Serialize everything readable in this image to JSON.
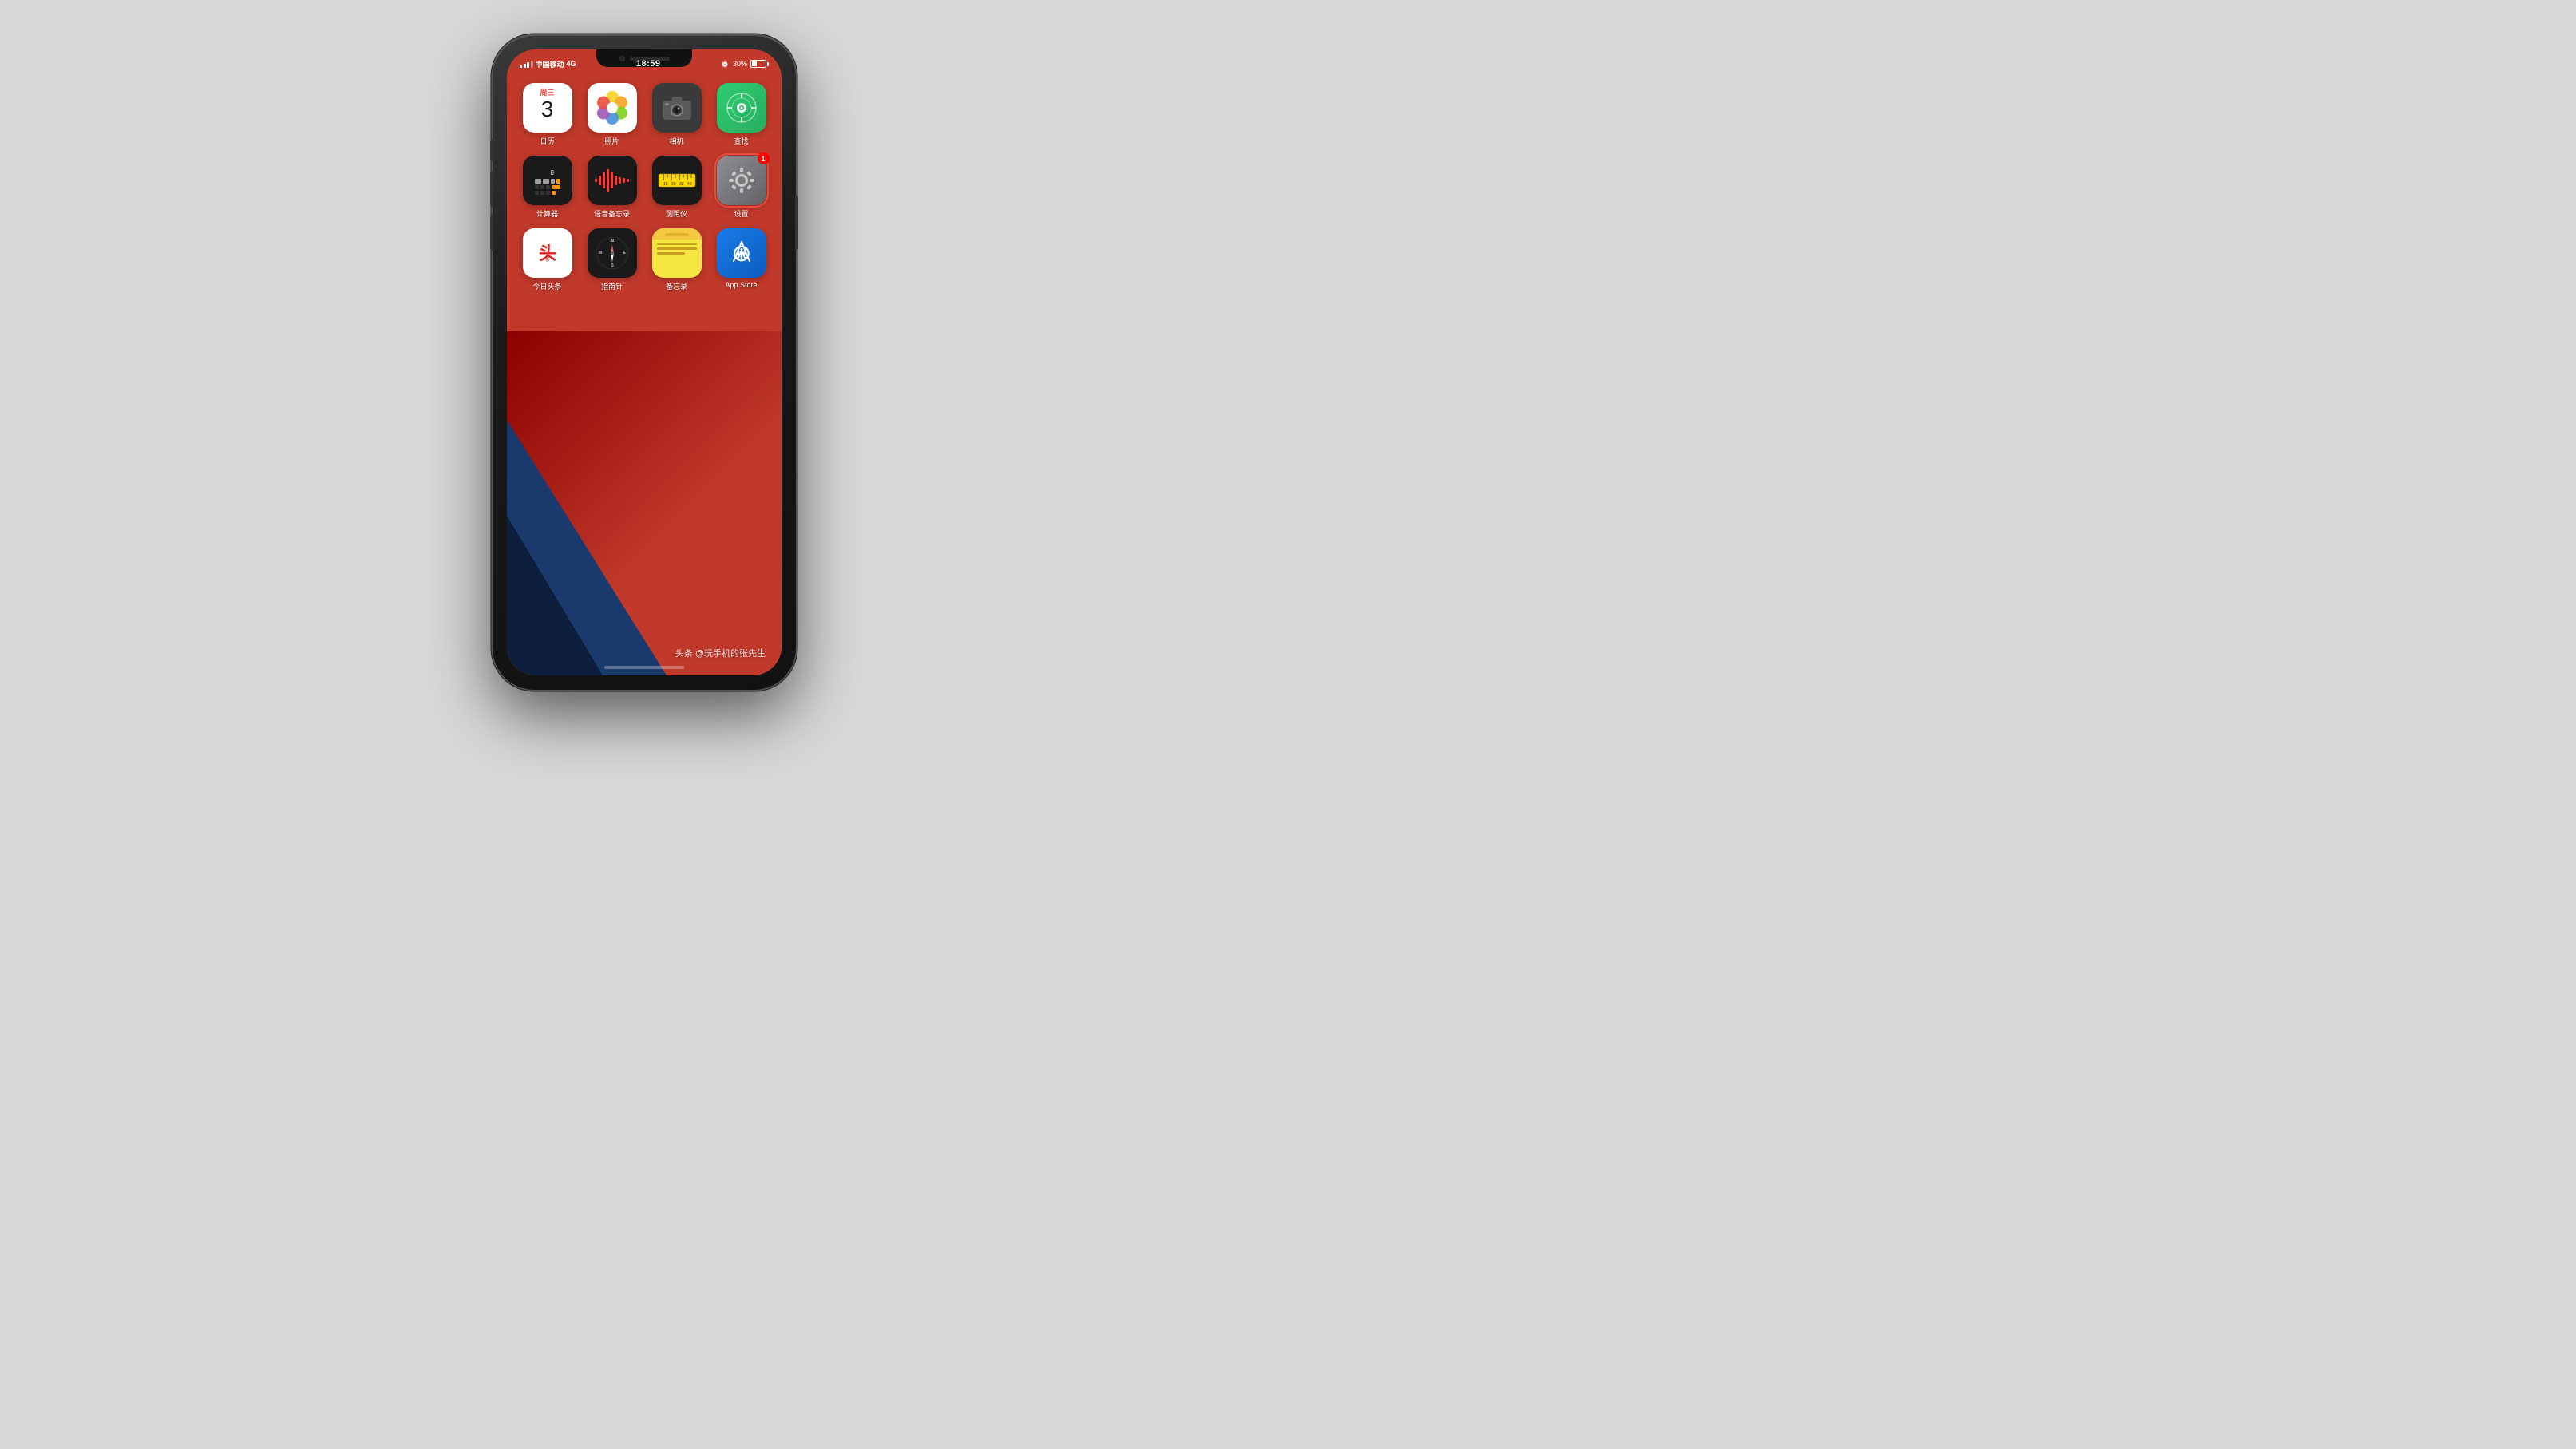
{
  "phone": {
    "status": {
      "carrier": "中国移动",
      "network": "4G",
      "time": "18:59",
      "battery_pct": "30%",
      "alarm": true
    },
    "wallpaper": "ios14-red",
    "apps": [
      {
        "id": "calendar",
        "label": "日历",
        "icon_type": "calendar",
        "day_label": "周三",
        "date": "3",
        "badge": null,
        "selected": false
      },
      {
        "id": "photos",
        "label": "照片",
        "icon_type": "photos",
        "badge": null,
        "selected": false
      },
      {
        "id": "camera",
        "label": "相机",
        "icon_type": "camera",
        "badge": null,
        "selected": false
      },
      {
        "id": "findmy",
        "label": "查找",
        "icon_type": "findmy",
        "badge": null,
        "selected": false
      },
      {
        "id": "calculator",
        "label": "计算器",
        "icon_type": "calculator",
        "badge": null,
        "selected": false
      },
      {
        "id": "voicememos",
        "label": "语音备忘录",
        "icon_type": "voicememos",
        "badge": null,
        "selected": false
      },
      {
        "id": "measure",
        "label": "测距仪",
        "icon_type": "measure",
        "badge": null,
        "selected": false
      },
      {
        "id": "settings",
        "label": "设置",
        "icon_type": "settings",
        "badge": "1",
        "selected": true
      },
      {
        "id": "toutiao",
        "label": "今日头条",
        "icon_type": "toutiao",
        "badge": null,
        "selected": false
      },
      {
        "id": "compass",
        "label": "指南针",
        "icon_type": "compass",
        "badge": null,
        "selected": false
      },
      {
        "id": "notes",
        "label": "备忘录",
        "icon_type": "notes",
        "badge": null,
        "selected": false
      },
      {
        "id": "appstore",
        "label": "App Store",
        "icon_type": "appstore",
        "badge": null,
        "selected": false
      }
    ],
    "watermark": "头条 @玩手机的张先生"
  }
}
